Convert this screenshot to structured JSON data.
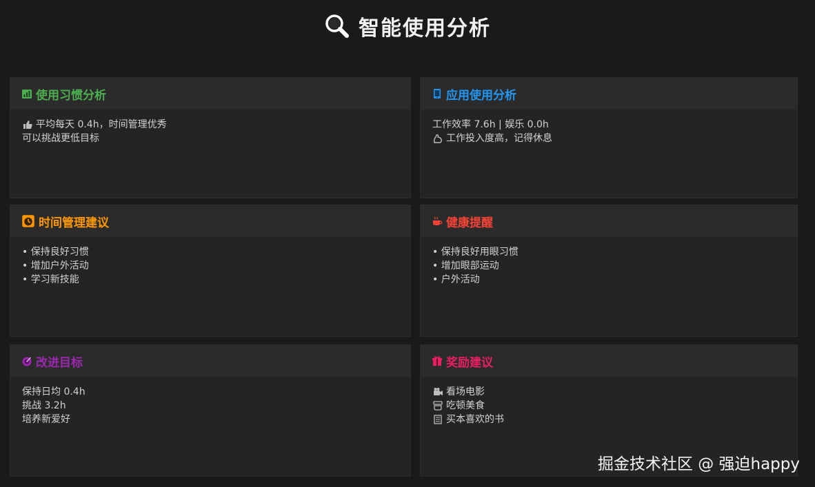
{
  "header": {
    "title": "智能使用分析",
    "icon": "magnifier-icon"
  },
  "cards": {
    "habit": {
      "title": "使用习惯分析",
      "title_color": "#4caf50",
      "icon": "bar-chart-icon",
      "lines": [
        {
          "icon": "thumbs-up-icon",
          "text": "平均每天 0.4h，时间管理优秀"
        },
        {
          "text": "可以挑战更低目标"
        }
      ]
    },
    "app": {
      "title": "应用使用分析",
      "title_color": "#2196f3",
      "icon": "phone-icon",
      "lines": [
        {
          "text": "工作效率 7.6h | 娱乐 0.0h"
        },
        {
          "icon": "flexed-arm-icon",
          "text": "工作投入度高，记得休息"
        }
      ]
    },
    "time": {
      "title": "时间管理建议",
      "title_color": "#ff9800",
      "icon": "alarm-clock-icon",
      "lines": [
        {
          "text": "• 保持良好习惯"
        },
        {
          "text": "• 增加户外活动"
        },
        {
          "text": "• 学习新技能"
        }
      ]
    },
    "health": {
      "title": "健康提醒",
      "title_color": "#f44336",
      "icon": "hot-beverage-icon",
      "lines": [
        {
          "text": "• 保持良好用眼习惯"
        },
        {
          "text": "• 增加眼部运动"
        },
        {
          "text": "• 户外活动"
        }
      ]
    },
    "goal": {
      "title": "改进目标",
      "title_color": "#9c27b0",
      "icon": "target-icon",
      "lines": [
        {
          "text": "保持日均 0.4h"
        },
        {
          "text": "挑战 3.2h"
        },
        {
          "text": "培养新爱好"
        }
      ]
    },
    "reward": {
      "title": "奖励建议",
      "title_color": "#e91e63",
      "icon": "gift-icon",
      "lines": [
        {
          "icon": "movie-camera-icon",
          "text": "看场电影"
        },
        {
          "icon": "food-icon",
          "text": "吃顿美食"
        },
        {
          "icon": "book-icon",
          "text": "买本喜欢的书"
        }
      ]
    }
  },
  "watermark": {
    "text": "掘金技术社区 @ 强迫happy"
  }
}
